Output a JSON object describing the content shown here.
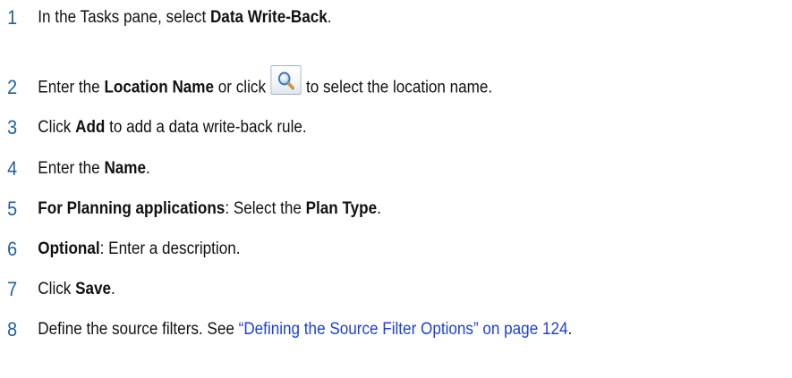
{
  "steps": [
    {
      "number": "1",
      "parts": [
        "In the Tasks pane, select ",
        "Data Write-Back",
        "."
      ]
    },
    {
      "number": "2",
      "parts": [
        "Enter the ",
        "Location Name",
        " or click",
        "to select the location name."
      ],
      "icon": "magnifier-search-icon"
    },
    {
      "number": "3",
      "parts": [
        "Click ",
        "Add",
        " to add a data write-back rule."
      ]
    },
    {
      "number": "4",
      "parts": [
        "Enter the ",
        "Name",
        "."
      ]
    },
    {
      "number": "5",
      "parts": [
        "For Planning applications",
        ": Select the ",
        "Plan Type",
        "."
      ]
    },
    {
      "number": "6",
      "parts": [
        "Optional",
        ": Enter a description."
      ]
    },
    {
      "number": "7",
      "parts": [
        "Click ",
        "Save",
        "."
      ]
    },
    {
      "number": "8",
      "parts": [
        "Define the source filters. See ",
        "“Defining the Source Filter Options” on page 124",
        "."
      ]
    }
  ],
  "colors": {
    "step_number": "#1f5f9c",
    "link": "#1f3fd6",
    "text": "#111111"
  }
}
